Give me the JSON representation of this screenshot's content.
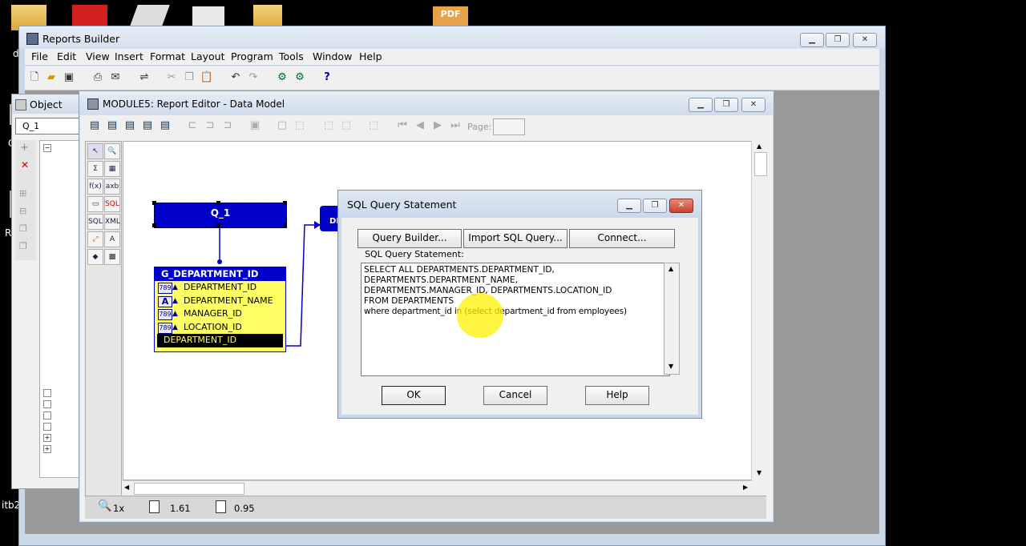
{
  "desktop": {
    "labels": [
      "d",
      "Co",
      "Re",
      "b",
      "it",
      "itb2"
    ],
    "pdf_badge": "PDF"
  },
  "app": {
    "title": "Reports Builder",
    "menus": [
      "File",
      "Edit",
      "View",
      "Insert",
      "Format",
      "Layout",
      "Program",
      "Tools",
      "Window",
      "Help"
    ]
  },
  "object_navigator": {
    "title": "Object",
    "find_value": "Q_1"
  },
  "editor": {
    "title": "MODULE5: Report Editor - Data Model",
    "page_label": "Page:",
    "page_value": ""
  },
  "data_model": {
    "query_name": "Q_1",
    "query2_partial": "DE",
    "group": {
      "title": "G_DEPARTMENT_ID",
      "columns": [
        {
          "type": "789",
          "name": "DEPARTMENT_ID"
        },
        {
          "type": "A",
          "name": "DEPARTMENT_NAME"
        },
        {
          "type": "789",
          "name": "MANAGER_ID"
        },
        {
          "type": "789",
          "name": "LOCATION_ID"
        }
      ],
      "selected": "DEPARTMENT_ID"
    }
  },
  "status": {
    "zoom": "1x",
    "x": "1.61",
    "y": "0.95"
  },
  "sql_dialog": {
    "title": "SQL Query Statement",
    "buttons_top": [
      "Query Builder...",
      "Import SQL Query...",
      "Connect..."
    ],
    "label": "SQL Query Statement:",
    "lines": [
      "SELECT ALL DEPARTMENTS.DEPARTMENT_ID,",
      "DEPARTMENTS.DEPARTMENT_NAME,",
      "DEPARTMENTS.MANAGER_ID, DEPARTMENTS.LOCATION_ID",
      "FROM DEPARTMENTS",
      "where department_id in (select department_id from employees)"
    ],
    "ok": "OK",
    "cancel": "Cancel",
    "help": "Help"
  }
}
